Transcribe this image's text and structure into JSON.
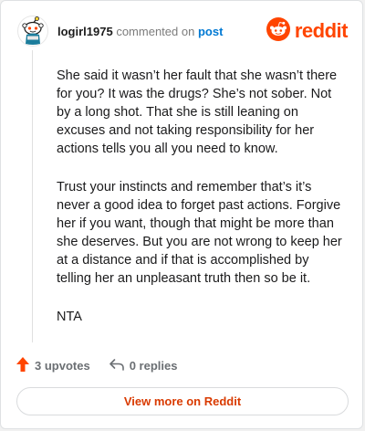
{
  "header": {
    "username": "logirl1975",
    "commented_text": "commented on",
    "post_link": "post",
    "brand": "reddit"
  },
  "comment": {
    "paragraphs": [
      "She said it wasn’t her fault that she wasn’t there for you? It was the drugs? She’s not sober. Not by a long shot. That she is still leaning on excuses and not taking responsibility for her actions tells you all you need to know.",
      "Trust your instincts and remember that’s it’s never a good idea to forget past actions. Forgive her if you want, though that might be more than she deserves. But you are not wrong to keep her at a distance and if that is accomplished by telling her an unpleasant truth then so be it.",
      "NTA"
    ]
  },
  "actions": {
    "upvotes_label": "3 upvotes",
    "replies_label": "0 replies"
  },
  "footer": {
    "view_more_label": "View more on Reddit"
  },
  "colors": {
    "brand_orange": "#ff4500",
    "link_blue": "#0079d3",
    "view_more_text": "#d93a00"
  },
  "icons": [
    "snoo-avatar-icon",
    "reddit-logo-icon",
    "upvote-arrow-icon",
    "reply-arrow-icon"
  ]
}
